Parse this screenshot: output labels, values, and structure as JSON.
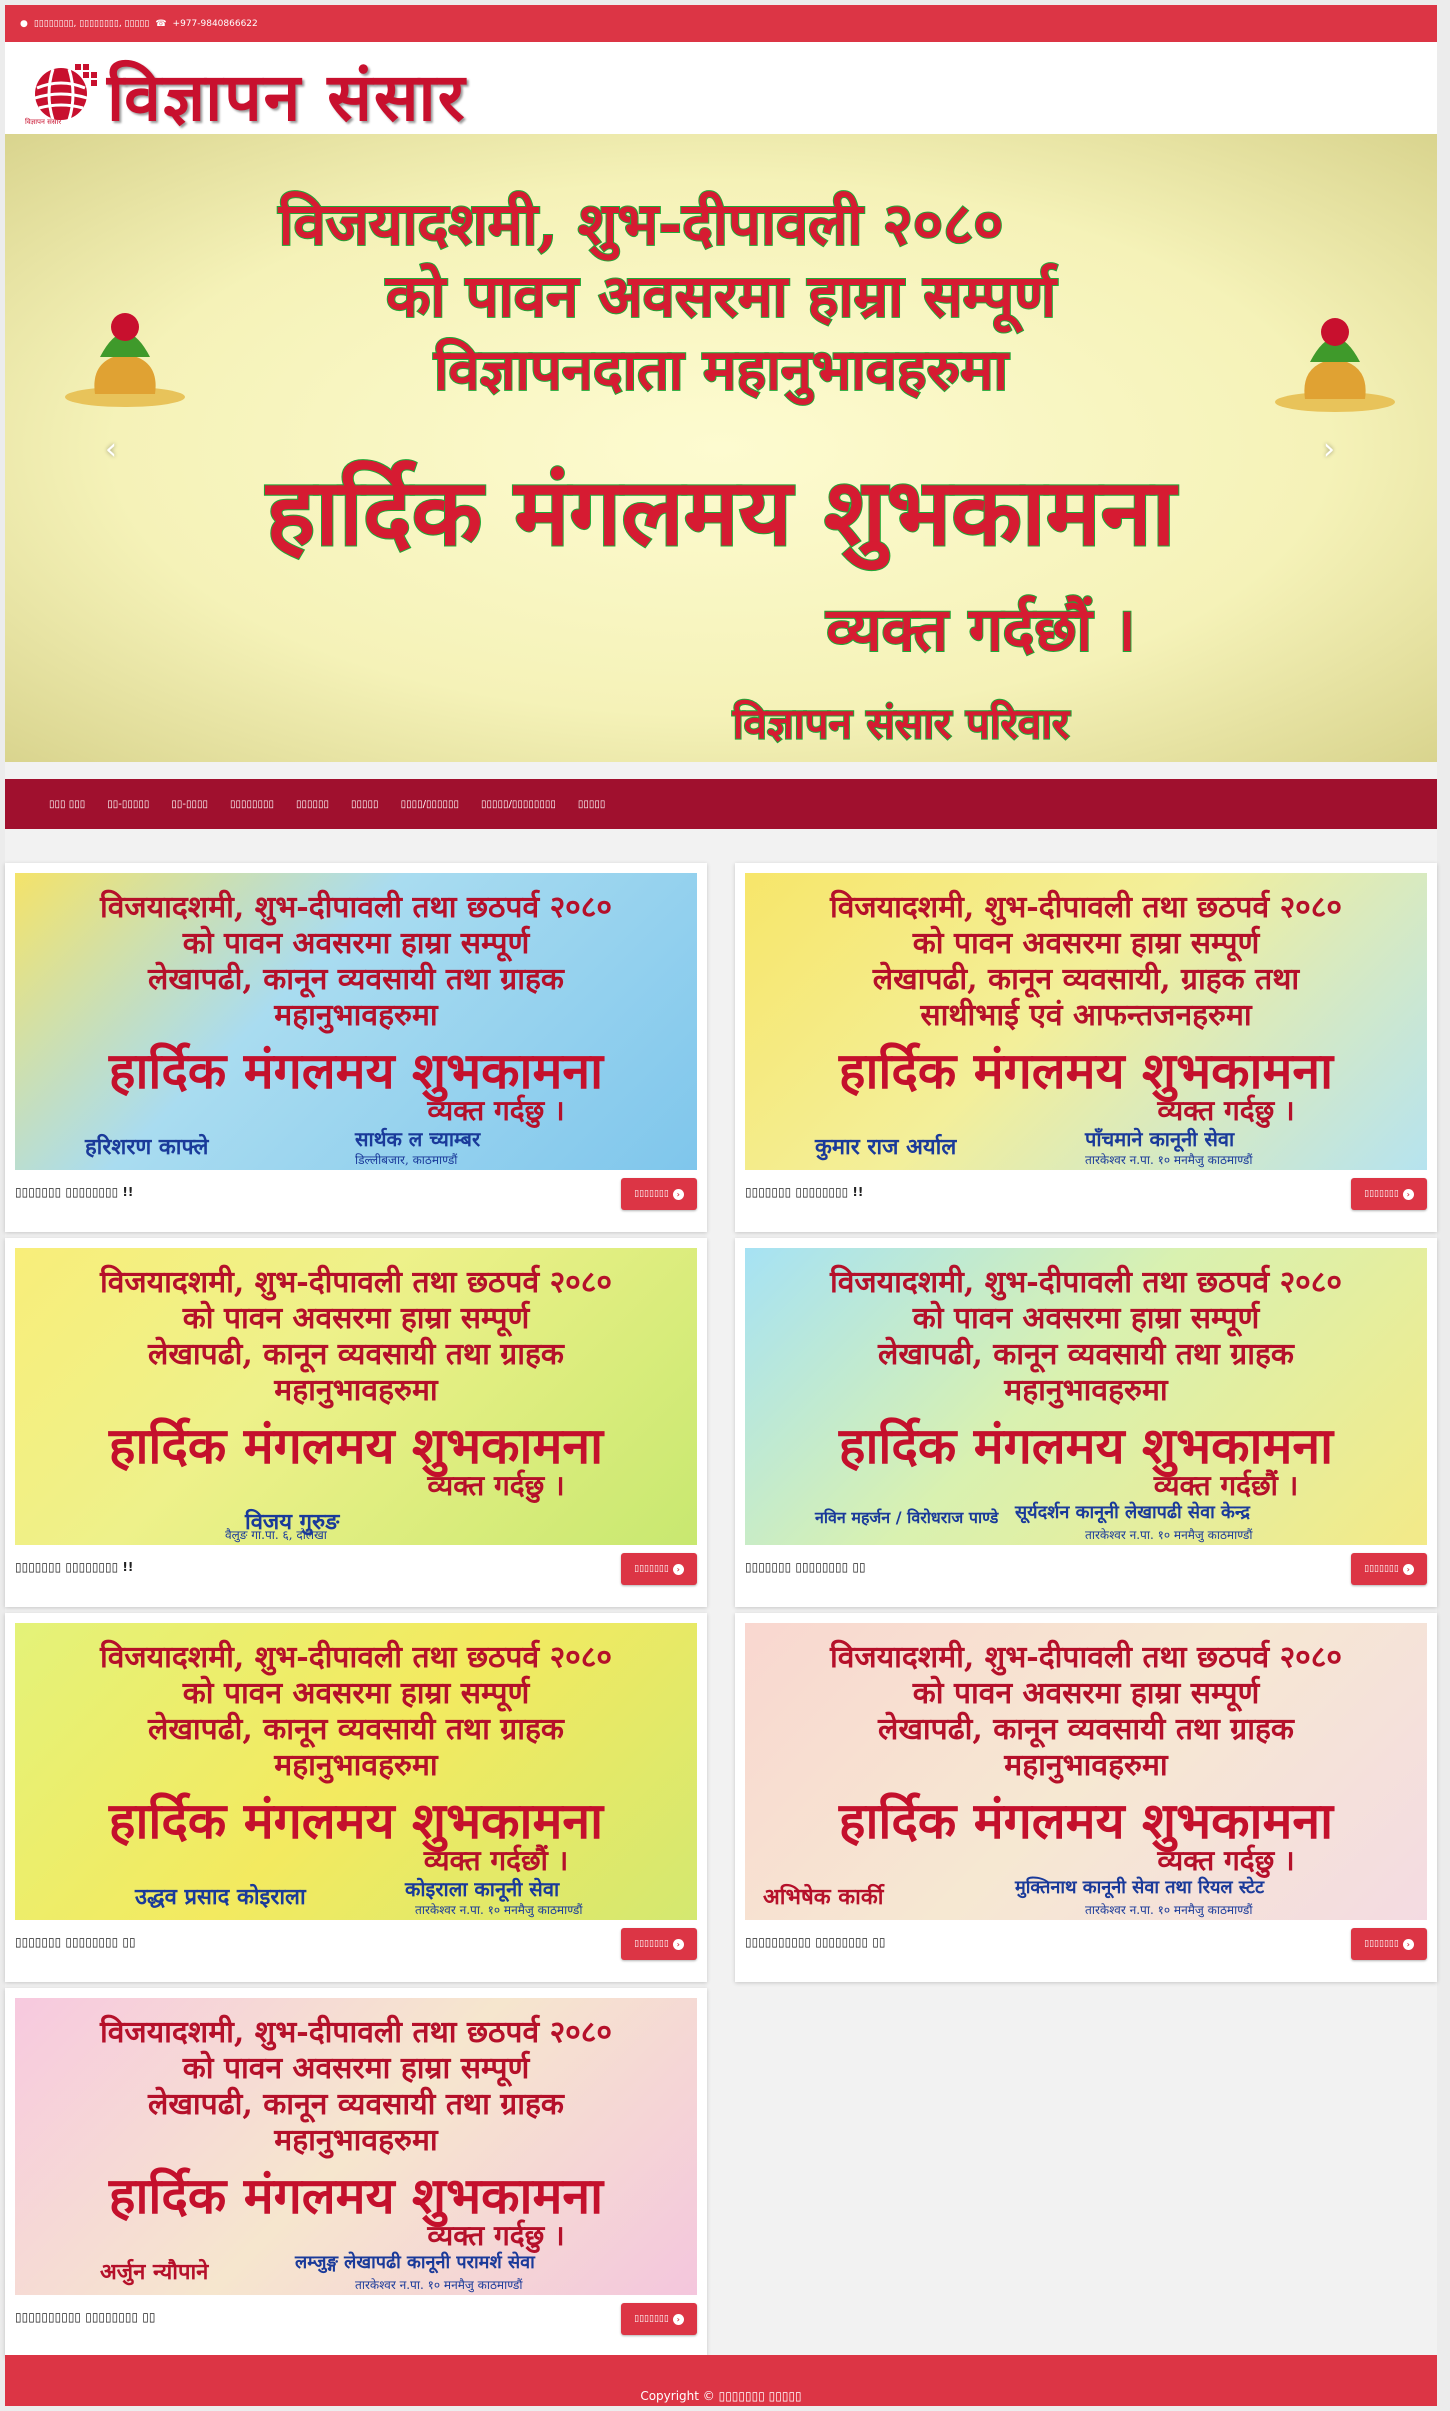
{
  "topbar": {
    "location_icon": "map-marker-icon",
    "location": "▯▯▯▯▯▯▯▯, ▯▯▯▯▯▯▯▯, ▯▯▯▯▯",
    "phone_icon": "phone-icon",
    "phone": "+977-9840866622"
  },
  "header": {
    "logo_text": "विज्ञापन संसार",
    "logo_sub": "विज्ञापन संसार"
  },
  "slider": {
    "line1": "विजयादशमी, शुभ-दीपावली २०८०",
    "line2": "को पावन अवसरमा हाम्रा सम्पूर्ण",
    "line3": "विज्ञापनदाता महानुभावहरुमा",
    "line4": "हार्दिक मंगलमय शुभकामना",
    "line5": "व्यक्त गर्दछौं ।",
    "line6": "विज्ञापन संसार परिवार",
    "prev": "‹",
    "next": "›"
  },
  "nav": {
    "items": [
      "▯▯▯ ▯▯▯",
      "▯▯-▯▯▯▯▯",
      "▯▯-▯▯▯▯",
      "▯▯▯▯▯▯▯▯",
      "▯▯▯▯▯▯",
      "▯▯▯▯▯",
      "▯▯▯▯/▯▯▯▯▯▯",
      "▯▯▯▯▯/▯▯▯▯▯▯▯▯",
      "▯▯▯▯▯"
    ]
  },
  "cards": [
    {
      "l1": "विजयादशमी, शुभ-दीपावली तथा छठपर्व २०८०",
      "l2": "को पावन अवसरमा हाम्रा सम्पूर्ण",
      "l3": "लेखापढी, कानून व्यवसायी तथा ग्राहक",
      "l4": "महानुभावहरुमा",
      "l5": "हार्दिक मंगलमय शुभकामना",
      "l6": "व्यक्त गर्दछु ।",
      "n1": "हरिशरण काफ्ले",
      "n2": "सार्थक ल च्याम्बर",
      "n3": "डिल्लीबजार, काठमाण्डौं",
      "caption": "▯▯▯▯▯▯▯ ▯▯▯▯▯▯▯▯ !!",
      "button": "▯▯▯▯▯▯▯",
      "bg": "linear-gradient(135deg,#f4e36a 0%,#a9dcf0 40%,#7fc6ec 100%)"
    },
    {
      "l1": "विजयादशमी, शुभ-दीपावली तथा छठपर्व २०८०",
      "l2": "को पावन अवसरमा हाम्रा सम्पूर्ण",
      "l3": "लेखापढी, कानून व्यवसायी, ग्राहक तथा",
      "l4": "साथीभाई एवं आफन्तजनहरुमा",
      "l5": "हार्दिक मंगलमय शुभकामना",
      "l6": "व्यक्त गर्दछु ।",
      "n1": "कुमार राज अर्याल",
      "n2": "पाँचमाने कानूनी सेवा",
      "n3": "तारकेश्वर न.पा. १० मनमैजु काठमाण्डौं",
      "caption": "▯▯▯▯▯▯▯ ▯▯▯▯▯▯▯▯ !!",
      "button": "▯▯▯▯▯▯▯",
      "bg": "linear-gradient(135deg,#f7e66a 0%,#f3ef9a 45%,#b6e3ef 100%)"
    },
    {
      "l1": "विजयादशमी, शुभ-दीपावली तथा छठपर्व २०८०",
      "l2": "को पावन अवसरमा हाम्रा सम्पूर्ण",
      "l3": "लेखापढी, कानून व्यवसायी तथा ग्राहक",
      "l4": "महानुभावहरुमा",
      "l5": "हार्दिक मंगलमय शुभकामना",
      "l6": "व्यक्त गर्दछु ।",
      "n1": "विजय गुरुङ",
      "n2": "",
      "n3": "वैलुङ गा.पा. ६, दोलखा",
      "caption": "▯▯▯▯▯▯▯ ▯▯▯▯▯▯▯▯ !!",
      "button": "▯▯▯▯▯▯▯",
      "bg": "linear-gradient(135deg,#f8ee7a 0%,#eef18a 40%,#c8e870 100%)"
    },
    {
      "l1": "विजयादशमी, शुभ-दीपावली तथा छठपर्व २०८०",
      "l2": "को पावन अवसरमा हाम्रा सम्पूर्ण",
      "l3": "लेखापढी, कानून व्यवसायी तथा ग्राहक",
      "l4": "महानुभावहरुमा",
      "l5": "हार्दिक मंगलमय शुभकामना",
      "l6": "व्यक्त गर्दछौं ।",
      "n1": "नविन महर्जन / विरोधराज पाण्डे",
      "n2": "सूर्यदर्शन कानूनी लेखापढी सेवा केन्द्र",
      "n3": "तारकेश्वर न.पा. १० मनमैजु काठमाण्डौं",
      "caption": "▯▯▯▯▯▯▯ ▯▯▯▯▯▯▯▯ ▯▯",
      "button": "▯▯▯▯▯▯▯",
      "bg": "linear-gradient(135deg,#a6e2f4 0%,#d9f1b0 45%,#f3ea88 100%)"
    },
    {
      "l1": "विजयादशमी, शुभ-दीपावली तथा छठपर्व २०८०",
      "l2": "को पावन अवसरमा हाम्रा सम्पूर्ण",
      "l3": "लेखापढी, कानून व्यवसायी तथा ग्राहक",
      "l4": "महानुभावहरुमा",
      "l5": "हार्दिक मंगलमय शुभकामना",
      "l6": "व्यक्त गर्दछौं ।",
      "n1": "उद्धव प्रसाद कोइराला",
      "n2": "कोइराला कानूनी सेवा",
      "n3": "तारकेश्वर न.पा. १० मनमैजु काठमाण्डौं",
      "caption": "▯▯▯▯▯▯▯ ▯▯▯▯▯▯▯▯ ▯▯",
      "button": "▯▯▯▯▯▯▯",
      "bg": "linear-gradient(135deg,#e4f279 0%,#f3ea60 50%,#d4e870 100%)"
    },
    {
      "l1": "विजयादशमी, शुभ-दीपावली तथा छठपर्व २०८०",
      "l2": "को पावन अवसरमा हाम्रा सम्पूर्ण",
      "l3": "लेखापढी, कानून व्यवसायी तथा ग्राहक",
      "l4": "महानुभावहरुमा",
      "l5": "हार्दिक मंगलमय शुभकामना",
      "l6": "व्यक्त गर्दछु ।",
      "n1": "अभिषेक कार्की",
      "n2": "मुक्तिनाथ कानूनी सेवा तथा रियल स्टेट",
      "n3": "तारकेश्वर न.पा. १० मनमैजु काठमाण्डौं",
      "caption": "▯▯▯▯▯▯▯▯▯▯ ▯▯▯▯▯▯▯▯ ▯▯",
      "button": "▯▯▯▯▯▯▯",
      "bg": "linear-gradient(135deg,#f9d7d0 0%,#f6e8d2 50%,#f4dbe2 100%)"
    },
    {
      "l1": "विजयादशमी, शुभ-दीपावली तथा छठपर्व २०८०",
      "l2": "को पावन अवसरमा हाम्रा सम्पूर्ण",
      "l3": "लेखापढी, कानून व्यवसायी तथा ग्राहक",
      "l4": "महानुभावहरुमा",
      "l5": "हार्दिक मंगलमय शुभकामना",
      "l6": "व्यक्त गर्दछु ।",
      "n1": "अर्जुन न्यौपाने",
      "n2": "लम्जुङ्ग लेखापढी कानूनी परामर्श सेवा",
      "n3": "तारकेश्वर न.पा. १० मनमैजु काठमाण्डौं",
      "caption": "▯▯▯▯▯▯▯▯▯▯ ▯▯▯▯▯▯▯▯ ▯▯",
      "button": "▯▯▯▯▯▯▯",
      "bg": "linear-gradient(135deg,#f7c9df 0%,#f6e6ce 50%,#f4c6dd 100%)"
    }
  ],
  "footer": {
    "copyright": "Copyright © ▯▯▯▯▯▯▯ ▯▯▯▯▯"
  },
  "colors": {
    "topbar": "#dc3545",
    "nav": "#a0102e",
    "button": "#dc3545",
    "footer": "#dc3545"
  }
}
